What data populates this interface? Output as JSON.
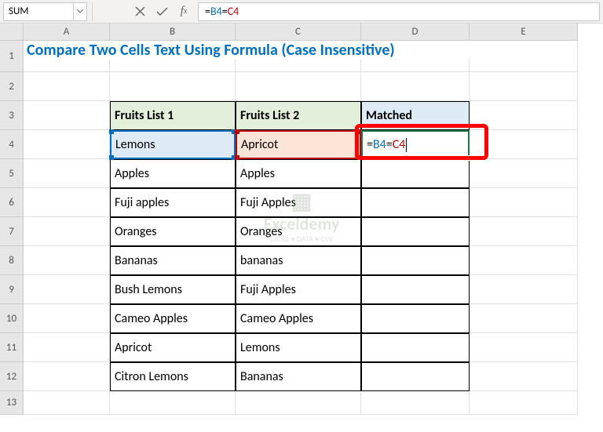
{
  "name_box": "SUM",
  "formula_bar": {
    "prefix": "=",
    "ref1": "B4",
    "mid": "=",
    "ref2": "C4"
  },
  "columns": [
    "A",
    "B",
    "C",
    "D",
    "E"
  ],
  "rows": [
    "1",
    "2",
    "3",
    "4",
    "5",
    "6",
    "7",
    "8",
    "9",
    "10",
    "11",
    "12",
    "13"
  ],
  "title": "Compare Two Cells Text Using Formula (Case Insensitive)",
  "headers": {
    "b": "Fruits List 1",
    "c": "Fruits List 2",
    "d": "Matched"
  },
  "table": [
    {
      "b": "Lemons",
      "c": "Apricot"
    },
    {
      "b": "Apples",
      "c": "Apples"
    },
    {
      "b": "Fuji apples",
      "c": "Fuji Apples"
    },
    {
      "b": "Oranges",
      "c": "Oranges"
    },
    {
      "b": "Bananas",
      "c": "bananas"
    },
    {
      "b": "Bush Lemons",
      "c": "Fuji Apples"
    },
    {
      "b": "Cameo Apples",
      "c": "Cameo Apples"
    },
    {
      "b": "Apricot",
      "c": "Lemons"
    },
    {
      "b": "Citron Lemons",
      "c": "Bananas"
    }
  ],
  "edit_cell": {
    "eq1": "=",
    "ref1": "B4",
    "eq2": "=",
    "ref2": "C4"
  },
  "watermark": {
    "main": "Exceldemy",
    "sub": "EXCEL • DATA • CSV"
  }
}
